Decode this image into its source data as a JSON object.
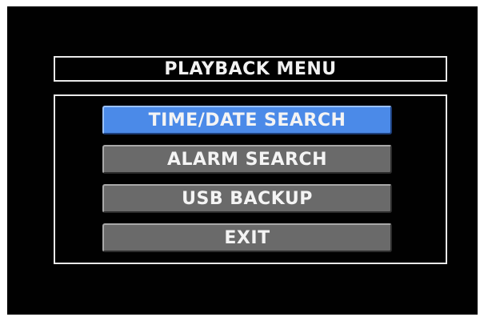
{
  "header": {
    "title": "PLAYBACK MENU"
  },
  "menu": {
    "items": [
      {
        "label": "TIME/DATE SEARCH",
        "selected": true
      },
      {
        "label": "ALARM SEARCH",
        "selected": false
      },
      {
        "label": "USB BACKUP",
        "selected": false
      },
      {
        "label": "EXIT",
        "selected": false
      }
    ]
  },
  "colors": {
    "background": "#010101",
    "frame": "#e9e9e9",
    "button": "#6a6a6a",
    "selected_button": "#4b8ae8",
    "text": "#f4f4f4"
  }
}
